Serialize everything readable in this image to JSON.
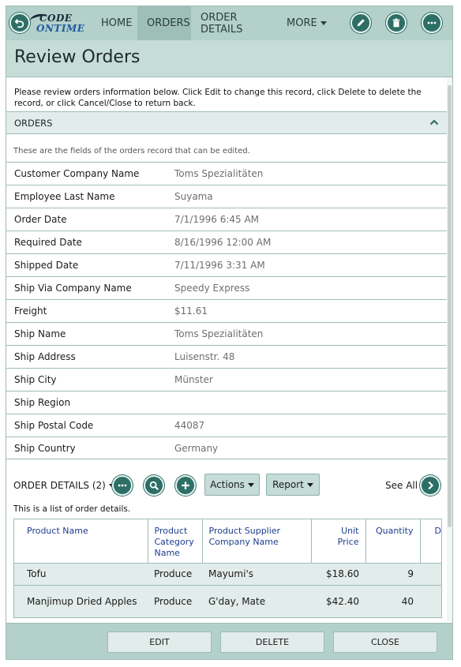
{
  "app": {
    "logo_line1": "CODE",
    "logo_line2": "ONTIME"
  },
  "nav": {
    "items": [
      {
        "label": "HOME"
      },
      {
        "label": "ORDERS"
      },
      {
        "label": "ORDER DETAILS"
      },
      {
        "label": "MORE"
      }
    ]
  },
  "page": {
    "title": "Review Orders",
    "description": "Please review orders information below. Click Edit to change this record, click Delete to delete the record, or click Cancel/Close to return back."
  },
  "section": {
    "title": "ORDERS",
    "note": "These are the fields of the orders record that can be edited."
  },
  "fields": [
    {
      "label": "Customer Company Name",
      "value": "Toms Spezialitäten"
    },
    {
      "label": "Employee Last Name",
      "value": "Suyama"
    },
    {
      "label": "Order Date",
      "value": "7/1/1996 6:45 AM"
    },
    {
      "label": "Required Date",
      "value": "8/16/1996 12:00 AM"
    },
    {
      "label": "Shipped Date",
      "value": "7/11/1996 3:31 AM"
    },
    {
      "label": "Ship Via Company Name",
      "value": "Speedy Express"
    },
    {
      "label": "Freight",
      "value": "$11.61"
    },
    {
      "label": "Ship Name",
      "value": "Toms Spezialitäten"
    },
    {
      "label": "Ship Address",
      "value": "Luisenstr. 48"
    },
    {
      "label": "Ship City",
      "value": "Münster"
    },
    {
      "label": "Ship Region",
      "value": ""
    },
    {
      "label": "Ship Postal Code",
      "value": "44087"
    },
    {
      "label": "Ship Country",
      "value": "Germany"
    }
  ],
  "order_details": {
    "title": "ORDER DETAILS (2)",
    "actions_label": "Actions",
    "report_label": "Report",
    "see_all_label": "See All",
    "note": "This is a list of order details.",
    "columns": [
      "Product Name",
      "Product Category Name",
      "Product Supplier Company Name",
      "Unit Price",
      "Quantity",
      "Di"
    ],
    "rows": [
      {
        "product": "Tofu",
        "category": "Produce",
        "supplier": "Mayumi's",
        "unit_price": "$18.60",
        "quantity": "9"
      },
      {
        "product": "Manjimup Dried Apples",
        "category": "Produce",
        "supplier": "G'day, Mate",
        "unit_price": "$42.40",
        "quantity": "40"
      }
    ]
  },
  "bottom": {
    "edit_label": "EDIT",
    "delete_label": "DELETE",
    "close_label": "CLOSE"
  },
  "colors": {
    "bar": "#b3d0ca",
    "title_bar": "#c6dcd7",
    "accent": "#2d6f66",
    "row_bg": "#e2ecea",
    "link": "#1c3d8f"
  }
}
